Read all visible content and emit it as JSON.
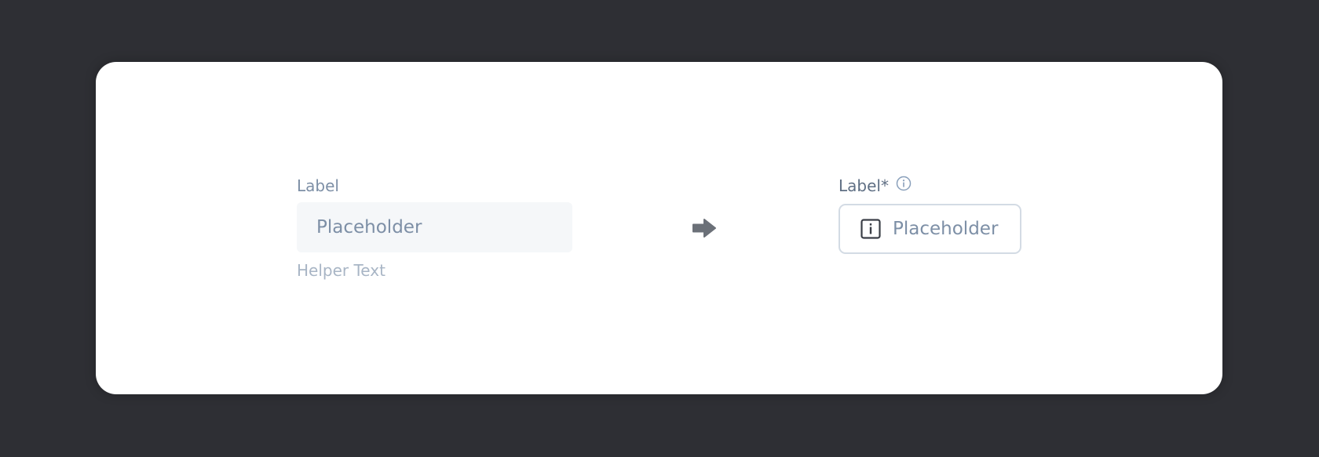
{
  "left_field": {
    "label": "Label",
    "placeholder": "Placeholder",
    "helper_text": "Helper Text"
  },
  "arrow": {
    "icon": "arrow-right-icon"
  },
  "right_field": {
    "label": "Label*",
    "label_icon": "info-circle-icon",
    "input_icon": "info-square-icon",
    "placeholder": "Placeholder"
  },
  "colors": {
    "background": "#2e2f34",
    "card": "#ffffff",
    "label_text": "#7d8fa6",
    "helper_text": "#a8b5c5",
    "input_fill": "#f5f7f9",
    "input_border": "#d3dbe4",
    "arrow": "#6b7078"
  }
}
